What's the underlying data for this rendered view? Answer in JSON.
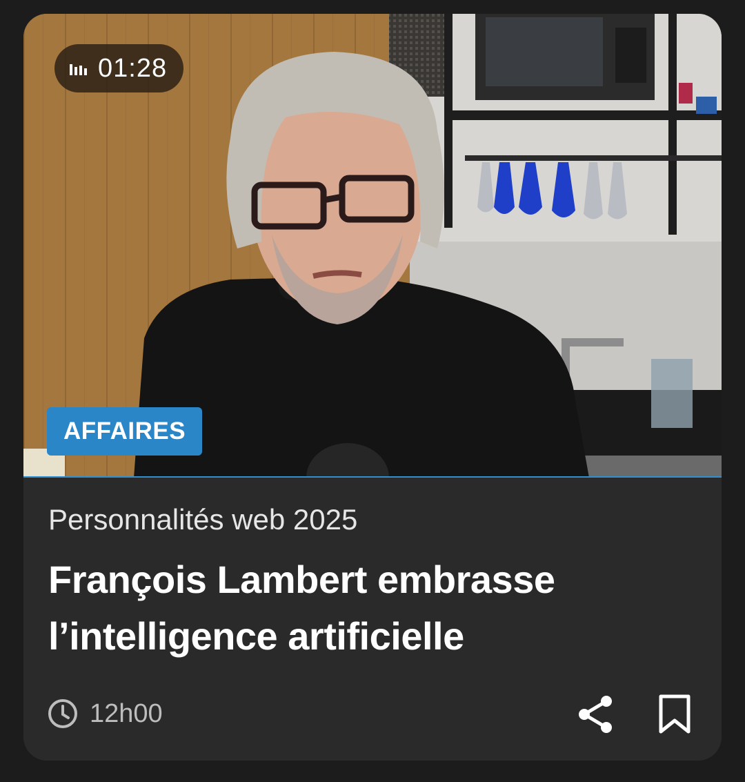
{
  "media": {
    "duration": "01:28",
    "duration_icon": "audio-bars-icon",
    "category": "AFFAIRES",
    "accent_color": "#2b86c8"
  },
  "article": {
    "kicker": "Personnalités web 2025",
    "headline_line1": "François Lambert embrasse",
    "headline_line2": "l’intelligence artificielle",
    "time": "12h00",
    "time_icon": "clock-icon"
  },
  "actions": {
    "share_icon": "share-icon",
    "bookmark_icon": "bookmark-icon"
  }
}
